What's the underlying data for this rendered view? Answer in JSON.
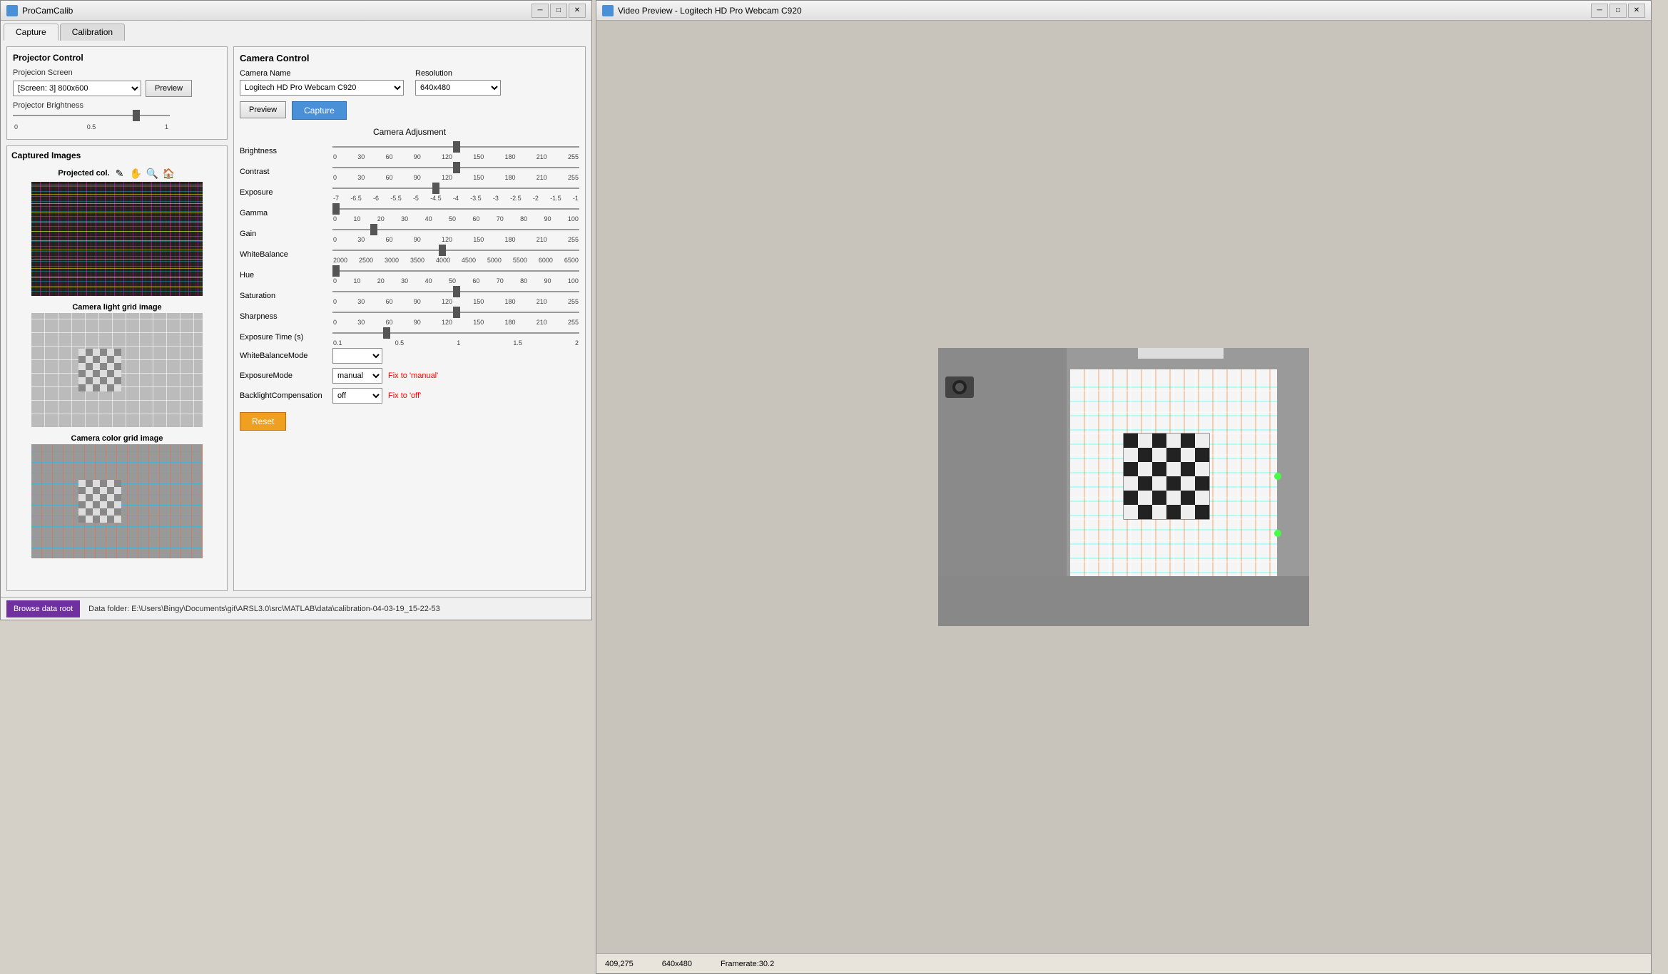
{
  "mainWindow": {
    "title": "ProCamCalib",
    "tabs": [
      "Capture",
      "Calibration"
    ],
    "activeTab": "Capture"
  },
  "projectorControl": {
    "title": "Projector Control",
    "screenLabel": "Projecion Screen",
    "screenValue": "[Screen: 3] 800x600",
    "screenOptions": [
      "[Screen: 3] 800x600"
    ],
    "previewBtn": "Preview",
    "brightnessLabel": "Projector Brightness",
    "brightnessTicks": [
      "0",
      "0.5",
      "1"
    ],
    "brightnessValue": 0.8
  },
  "capturedImages": {
    "title": "Captured Images",
    "images": [
      {
        "name": "projected-col",
        "title": "Projected col.",
        "type": "projected"
      },
      {
        "name": "camera-light-grid",
        "title": "Camera light grid image",
        "type": "light-grid"
      },
      {
        "name": "camera-color-grid",
        "title": "Camera color grid image",
        "type": "color-grid"
      }
    ]
  },
  "cameraControl": {
    "title": "Camera Control",
    "cameraNameLabel": "Camera Name",
    "cameraNameValue": "Logitech HD Pro Webcam C920",
    "cameraOptions": [
      "Logitech HD Pro Webcam C920"
    ],
    "resolutionLabel": "Resolution",
    "resolutionValue": "640x480",
    "resolutionOptions": [
      "640x480"
    ],
    "previewBtn": "Preview",
    "captureBtn": "Capture",
    "adjTitle": "Camera Adjusment",
    "sliders": [
      {
        "label": "Brightness",
        "ticks": [
          "0",
          "30",
          "60",
          "90",
          "120",
          "150",
          "180",
          "210",
          "255"
        ],
        "value": 128,
        "min": 0,
        "max": 255
      },
      {
        "label": "Contrast",
        "ticks": [
          "0",
          "30",
          "60",
          "90",
          "120",
          "150",
          "180",
          "210",
          "255"
        ],
        "value": 128,
        "min": 0,
        "max": 255
      },
      {
        "label": "Exposure",
        "ticks": [
          "-7",
          "-6.5",
          "-6",
          "-5.5",
          "-5",
          "-4.5",
          "-4",
          "-3.5",
          "-3",
          "-2.5",
          "-2",
          "-1.5",
          "-1"
        ],
        "value": -4.5,
        "min": -7,
        "max": -1
      },
      {
        "label": "Gamma",
        "ticks": [
          "0",
          "10",
          "20",
          "30",
          "40",
          "50",
          "60",
          "70",
          "80",
          "90",
          "100"
        ],
        "value": 0,
        "min": 0,
        "max": 100
      },
      {
        "label": "Gain",
        "ticks": [
          "0",
          "30",
          "60",
          "90",
          "120",
          "150",
          "180",
          "210",
          "255"
        ],
        "value": 40,
        "min": 0,
        "max": 255
      },
      {
        "label": "WhiteBalance",
        "ticks": [
          "2000",
          "2500",
          "3000",
          "3500",
          "4000",
          "4500",
          "5000",
          "5500",
          "6000",
          "6500"
        ],
        "value": 4000,
        "min": 2000,
        "max": 6500
      },
      {
        "label": "Hue",
        "ticks": [
          "0",
          "10",
          "20",
          "30",
          "40",
          "50",
          "60",
          "70",
          "80",
          "90",
          "100"
        ],
        "value": 0,
        "min": 0,
        "max": 100
      },
      {
        "label": "Saturation",
        "ticks": [
          "0",
          "30",
          "60",
          "90",
          "120",
          "150",
          "180",
          "210",
          "255"
        ],
        "value": 128,
        "min": 0,
        "max": 255
      },
      {
        "label": "Sharpness",
        "ticks": [
          "0",
          "30",
          "60",
          "90",
          "120",
          "150",
          "180",
          "210",
          "255"
        ],
        "value": 128,
        "min": 0,
        "max": 255
      },
      {
        "label": "Exposure Time (s)",
        "ticks": [
          "0.1",
          "0.5",
          "1",
          "1.5",
          "2"
        ],
        "value": 0.5,
        "min": 0.1,
        "max": 2
      }
    ],
    "dropdowns": [
      {
        "label": "WhiteBalanceMode",
        "value": "",
        "fixText": ""
      },
      {
        "label": "ExposureMode",
        "value": "manual",
        "options": [
          "manual"
        ],
        "fixText": "Fix to 'manual'"
      },
      {
        "label": "BacklightCompensation",
        "value": "off",
        "options": [
          "off"
        ],
        "fixText": "Fix to 'off'"
      }
    ],
    "resetBtn": "Reset"
  },
  "bottomBar": {
    "browseBtn": "Browse data root",
    "dataFolderText": "Data folder: E:\\Users\\Bingy\\Documents\\git\\ARSL3.0\\src\\MATLAB\\data\\calibration-04-03-19_15-22-53"
  },
  "previewWindow": {
    "title": "Video Preview - Logitech HD Pro Webcam C920",
    "status": {
      "coords": "409,275",
      "resolution": "640x480",
      "framerate": "Framerate:30.2"
    }
  }
}
